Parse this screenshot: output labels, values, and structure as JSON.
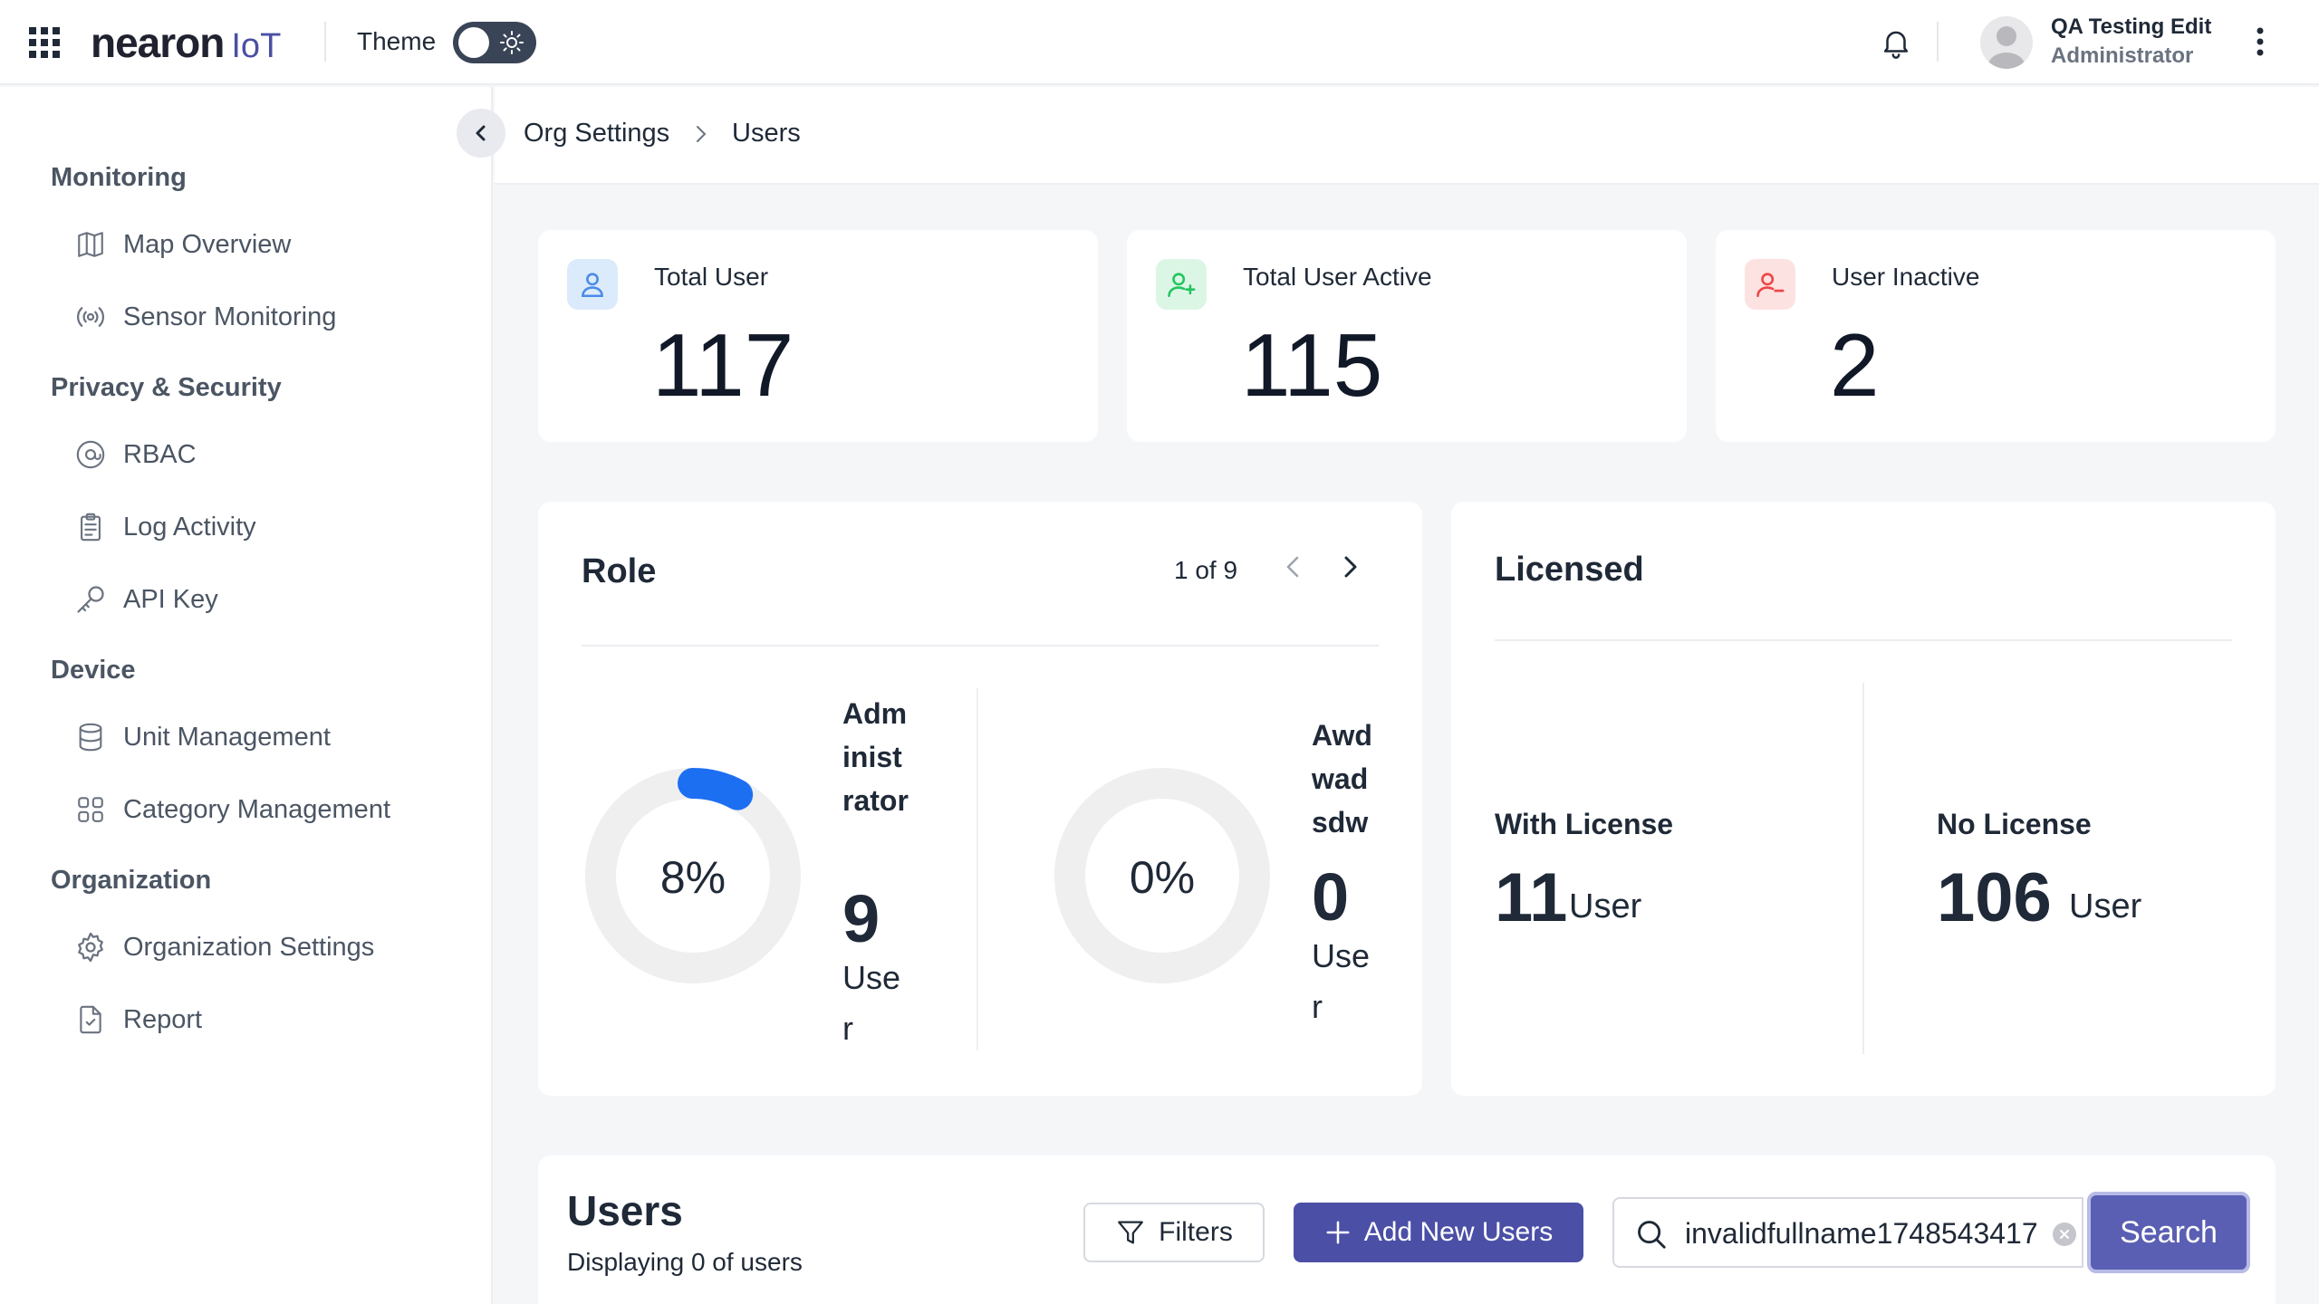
{
  "header": {
    "logo_main": "nearon",
    "logo_sub": "IoT",
    "theme_label": "Theme",
    "user_name": "QA Testing Edit",
    "user_role": "Administrator"
  },
  "sidebar": {
    "sections": [
      {
        "title": "Monitoring",
        "items": [
          {
            "label": "Map Overview",
            "icon": "map-icon"
          },
          {
            "label": "Sensor Monitoring",
            "icon": "sensor-icon"
          }
        ]
      },
      {
        "title": "Privacy & Security",
        "items": [
          {
            "label": "RBAC",
            "icon": "at-sign-icon"
          },
          {
            "label": "Log Activity",
            "icon": "clipboard-icon"
          },
          {
            "label": "API Key",
            "icon": "key-icon"
          }
        ]
      },
      {
        "title": "Device",
        "items": [
          {
            "label": "Unit Management",
            "icon": "database-icon"
          },
          {
            "label": "Category Management",
            "icon": "grid-icon"
          }
        ]
      },
      {
        "title": "Organization",
        "items": [
          {
            "label": "Organization Settings",
            "icon": "gear-icon"
          },
          {
            "label": "Report",
            "icon": "report-icon"
          }
        ]
      }
    ]
  },
  "breadcrumb": {
    "parent": "Org Settings",
    "current": "Users"
  },
  "stats": [
    {
      "label": "Total User",
      "value": "117",
      "icon": "user-icon",
      "color": "#4a8be8"
    },
    {
      "label": "Total User Active",
      "value": "115",
      "icon": "user-plus-icon",
      "color": "#22c55e"
    },
    {
      "label": "User Inactive",
      "value": "2",
      "icon": "user-minus-icon",
      "color": "#ef4444"
    }
  ],
  "role": {
    "title": "Role",
    "pager": "1 of 9",
    "items": [
      {
        "name": "Administrator",
        "percent": "8%",
        "fraction": 0.08,
        "count": "9",
        "unit": "User"
      },
      {
        "name": "Awdwadsdw",
        "percent": "0%",
        "fraction": 0,
        "count": "0",
        "unit": "User"
      }
    ]
  },
  "licensed": {
    "title": "Licensed",
    "with_label": "With License",
    "with_count": "11",
    "no_label": "No License",
    "no_count": "106",
    "unit": "User"
  },
  "users": {
    "title": "Users",
    "subtitle": "Displaying 0 of users",
    "filters_label": "Filters",
    "add_label": "Add New Users",
    "search_value": "invalidfullname1748543417",
    "search_label": "Search"
  },
  "colors": {
    "accent": "#4b4fa6",
    "donut_fill": "#1d6ff2",
    "donut_track": "#efefef"
  }
}
